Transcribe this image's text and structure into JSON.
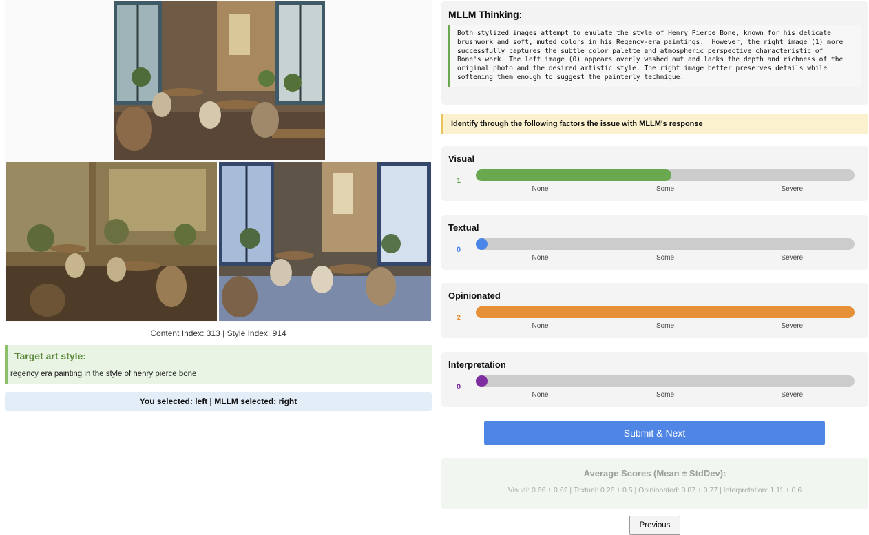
{
  "images": {
    "top": {
      "label": "content-photo"
    },
    "left": {
      "label": "stylized-image-0"
    },
    "right": {
      "label": "stylized-image-1"
    }
  },
  "caption": "Content Index: 313 | Style Index: 914",
  "target": {
    "title": "Target art style:",
    "text": "regency era painting in the style of henry pierce bone"
  },
  "selection": "You selected: left | MLLM selected: right",
  "thinking": {
    "title": "MLLM Thinking:",
    "text": "Both stylized images attempt to emulate the style of Henry Pierce Bone, known for his delicate\nbrushwork and soft, muted colors in his Regency-era paintings.  However, the right image (1) more\nsuccessfully captures the subtle color palette and atmospheric perspective characteristic of\nBone's work. The left image (0) appears overly washed out and lacks the depth and richness of the\noriginal photo and the desired artistic style. The right image better preserves details while\nsoftening them enough to suggest the painterly technique."
  },
  "instruction": "Identify through the following factors the issue with MLLM's response",
  "factors": [
    {
      "title": "Visual",
      "value": "1",
      "level": 1,
      "color": "#6aa84f"
    },
    {
      "title": "Textual",
      "value": "0",
      "level": 0,
      "color": "#4a86e8"
    },
    {
      "title": "Opinionated",
      "value": "2",
      "level": 2,
      "color": "#e69138"
    },
    {
      "title": "Interpretation",
      "value": "0",
      "level": 0,
      "color": "#7e2ea0"
    }
  ],
  "scale_labels": [
    "None",
    "Some",
    "Severe"
  ],
  "submit_label": "Submit & Next",
  "averages": {
    "title": "Average Scores (Mean ± StdDev):",
    "text": "Visual: 0.66 ± 0.62 | Textual: 0.26 ± 0.5 | Opinionated: 0.87 ± 0.77 | Interpretation: 1.11 ± 0.6"
  },
  "previous_label": "Previous"
}
